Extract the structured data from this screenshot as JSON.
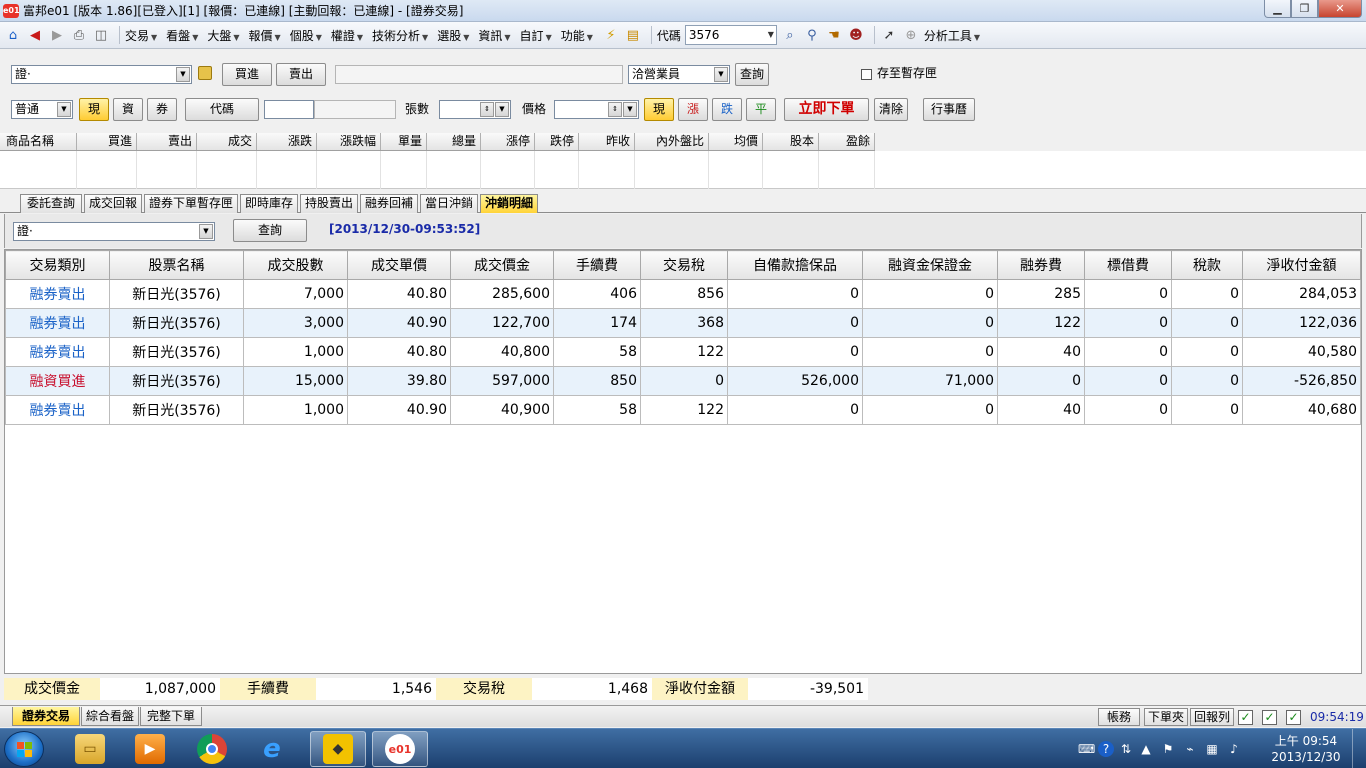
{
  "window": {
    "title": "富邦e01 [版本 1.86][已登入][1] [報價：已連線] [主動回報：已連線] - [證券交易]",
    "app_icon": "e01"
  },
  "menubar": {
    "items": [
      "交易",
      "看盤",
      "大盤",
      "報價",
      "個股",
      "權證",
      "技術分析",
      "選股",
      "資訊",
      "自訂",
      "功能"
    ],
    "code_label": "代碼",
    "code_value": "3576",
    "analysis_tools": "分析工具"
  },
  "order_form": {
    "account_value": "證·",
    "buy_label": "買進",
    "sell_label": "賣出",
    "agent_value": "洽營業員",
    "query_label": "查詢",
    "save_temp_label": "存至暫存匣",
    "order_type_value": "普通",
    "cash_label": "現",
    "margin_label": "資",
    "short_label": "券",
    "code_btn_label": "代碼",
    "lots_label": "張數",
    "price_label": "價格",
    "price_cash_label": "現",
    "up_label": "漲",
    "down_label": "跌",
    "flat_label": "平",
    "submit_label": "立即下單",
    "clear_label": "清除",
    "calendar_label": "行事曆"
  },
  "quote_header": {
    "columns": [
      "商品名稱",
      "買進",
      "賣出",
      "成交",
      "漲跌",
      "漲跌幅",
      "單量",
      "總量",
      "漲停",
      "跌停",
      "昨收",
      "內外盤比",
      "均價",
      "股本",
      "盈餘"
    ]
  },
  "tabs": {
    "items": [
      "委託查詢",
      "成交回報",
      "證券下單暫存匣",
      "即時庫存",
      "持股賣出",
      "融券回補",
      "當日沖銷",
      "沖銷明細"
    ],
    "active": "沖銷明細"
  },
  "inner_toolbar": {
    "account_value": "證·",
    "query_label": "查詢",
    "timestamp": "[2013/12/30-09:53:52]"
  },
  "table": {
    "headers": [
      "交易類別",
      "股票名稱",
      "成交股數",
      "成交單價",
      "成交價金",
      "手續費",
      "交易稅",
      "自備款擔保品",
      "融資金保證金",
      "融券費",
      "標借費",
      "稅款",
      "淨收付金額"
    ],
    "rows": [
      [
        "融券賣出",
        "新日光(3576)",
        "7,000",
        "40.80",
        "285,600",
        "406",
        "856",
        "0",
        "0",
        "285",
        "0",
        "0",
        "284,053"
      ],
      [
        "融券賣出",
        "新日光(3576)",
        "3,000",
        "40.90",
        "122,700",
        "174",
        "368",
        "0",
        "0",
        "122",
        "0",
        "0",
        "122,036"
      ],
      [
        "融券賣出",
        "新日光(3576)",
        "1,000",
        "40.80",
        "40,800",
        "58",
        "122",
        "0",
        "0",
        "40",
        "0",
        "0",
        "40,580"
      ],
      [
        "融資買進",
        "新日光(3576)",
        "15,000",
        "39.80",
        "597,000",
        "850",
        "0",
        "526,000",
        "71,000",
        "0",
        "0",
        "0",
        "-526,850"
      ],
      [
        "融券賣出",
        "新日光(3576)",
        "1,000",
        "40.90",
        "40,900",
        "58",
        "122",
        "0",
        "0",
        "40",
        "0",
        "0",
        "40,680"
      ]
    ],
    "colors": {
      "short_sell": "#1a62c7",
      "margin_buy": "#c8102e"
    }
  },
  "summary": {
    "amount_label": "成交價金",
    "amount_value": "1,087,000",
    "fee_label": "手續費",
    "fee_value": "1,546",
    "tax_label": "交易稅",
    "tax_value": "1,468",
    "net_label": "淨收付金額",
    "net_value": "-39,501"
  },
  "bottom_bar": {
    "tabs": [
      "證券交易",
      "綜合看盤",
      "完整下單"
    ],
    "account_label": "帳務",
    "order_folder_label": "下單夾",
    "report_label": "回報列",
    "time": "09:54:19"
  },
  "taskbar": {
    "clock_time": "上午 09:54",
    "clock_date": "2013/12/30",
    "e01_label": "e01"
  }
}
